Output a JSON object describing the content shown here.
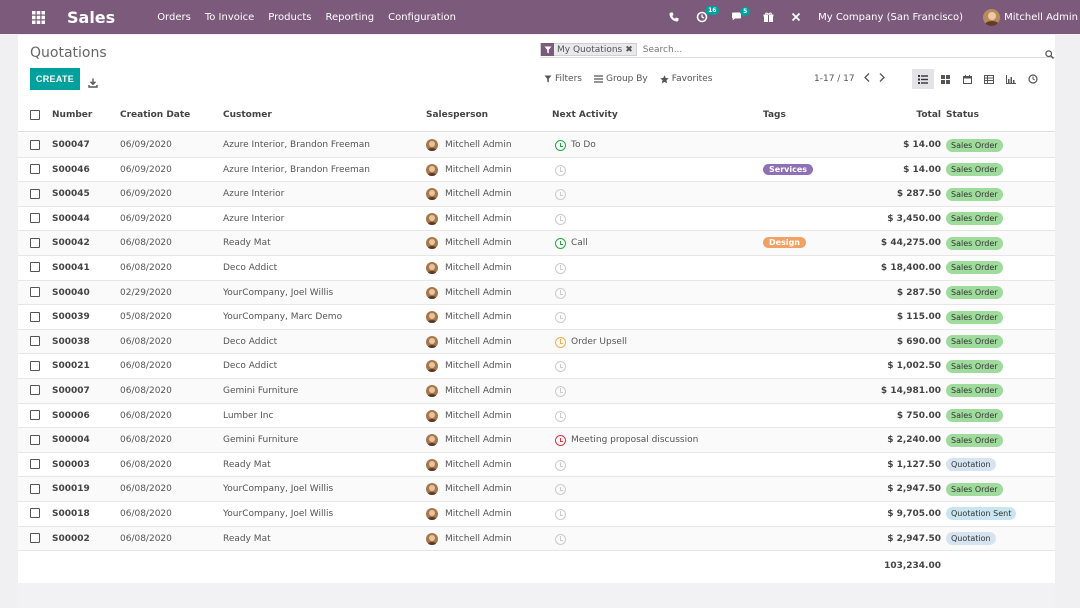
{
  "topbar": {
    "app_title": "Sales",
    "menu": [
      "Orders",
      "To Invoice",
      "Products",
      "Reporting",
      "Configuration"
    ],
    "activity_count": "16",
    "message_count": "5",
    "company": "My Company (San Francisco)",
    "user": "Mitchell Admin"
  },
  "breadcrumb": "Quotations",
  "search": {
    "facet_label": "My Quotations",
    "placeholder": "Search..."
  },
  "toolbar": {
    "create_label": "CREATE",
    "filters_label": "Filters",
    "groupby_label": "Group By",
    "favorites_label": "Favorites",
    "pager": "1-17 / 17"
  },
  "columns": {
    "number": "Number",
    "creation_date": "Creation Date",
    "customer": "Customer",
    "salesperson": "Salesperson",
    "next_activity": "Next Activity",
    "tags": "Tags",
    "total": "Total",
    "status": "Status"
  },
  "rows": [
    {
      "number": "S00047",
      "date": "06/09/2020",
      "customer": "Azure Interior, Brandon Freeman",
      "salesperson": "Mitchell Admin",
      "activity": "To Do",
      "activity_state": "todo",
      "tag": "",
      "total": "$ 14.00",
      "status": "Sales Order"
    },
    {
      "number": "S00046",
      "date": "06/09/2020",
      "customer": "Azure Interior, Brandon Freeman",
      "salesperson": "Mitchell Admin",
      "activity": "",
      "activity_state": "empty",
      "tag": "Services",
      "total": "$ 14.00",
      "status": "Sales Order"
    },
    {
      "number": "S00045",
      "date": "06/09/2020",
      "customer": "Azure Interior",
      "salesperson": "Mitchell Admin",
      "activity": "",
      "activity_state": "empty",
      "tag": "",
      "total": "$ 287.50",
      "status": "Sales Order"
    },
    {
      "number": "S00044",
      "date": "06/09/2020",
      "customer": "Azure Interior",
      "salesperson": "Mitchell Admin",
      "activity": "",
      "activity_state": "empty",
      "tag": "",
      "total": "$ 3,450.00",
      "status": "Sales Order"
    },
    {
      "number": "S00042",
      "date": "06/08/2020",
      "customer": "Ready Mat",
      "salesperson": "Mitchell Admin",
      "activity": "Call",
      "activity_state": "todo",
      "tag": "Design",
      "total": "$ 44,275.00",
      "status": "Sales Order"
    },
    {
      "number": "S00041",
      "date": "06/08/2020",
      "customer": "Deco Addict",
      "salesperson": "Mitchell Admin",
      "activity": "",
      "activity_state": "empty",
      "tag": "",
      "total": "$ 18,400.00",
      "status": "Sales Order"
    },
    {
      "number": "S00040",
      "date": "02/29/2020",
      "customer": "YourCompany, Joel Willis",
      "salesperson": "Mitchell Admin",
      "activity": "",
      "activity_state": "empty",
      "tag": "",
      "total": "$ 287.50",
      "status": "Sales Order"
    },
    {
      "number": "S00039",
      "date": "05/08/2020",
      "customer": "YourCompany, Marc Demo",
      "salesperson": "Mitchell Admin",
      "activity": "",
      "activity_state": "empty",
      "tag": "",
      "total": "$ 115.00",
      "status": "Sales Order"
    },
    {
      "number": "S00038",
      "date": "06/08/2020",
      "customer": "Deco Addict",
      "salesperson": "Mitchell Admin",
      "activity": "Order Upsell",
      "activity_state": "warn",
      "tag": "",
      "total": "$ 690.00",
      "status": "Sales Order"
    },
    {
      "number": "S00021",
      "date": "06/08/2020",
      "customer": "Deco Addict",
      "salesperson": "Mitchell Admin",
      "activity": "",
      "activity_state": "empty",
      "tag": "",
      "total": "$ 1,002.50",
      "status": "Sales Order"
    },
    {
      "number": "S00007",
      "date": "06/08/2020",
      "customer": "Gemini Furniture",
      "salesperson": "Mitchell Admin",
      "activity": "",
      "activity_state": "empty",
      "tag": "",
      "total": "$ 14,981.00",
      "status": "Sales Order"
    },
    {
      "number": "S00006",
      "date": "06/08/2020",
      "customer": "Lumber Inc",
      "salesperson": "Mitchell Admin",
      "activity": "",
      "activity_state": "empty",
      "tag": "",
      "total": "$ 750.00",
      "status": "Sales Order"
    },
    {
      "number": "S00004",
      "date": "06/08/2020",
      "customer": "Gemini Furniture",
      "salesperson": "Mitchell Admin",
      "activity": "Meeting proposal discussion",
      "activity_state": "late",
      "tag": "",
      "total": "$ 2,240.00",
      "status": "Sales Order"
    },
    {
      "number": "S00003",
      "date": "06/08/2020",
      "customer": "Ready Mat",
      "salesperson": "Mitchell Admin",
      "activity": "",
      "activity_state": "empty",
      "tag": "",
      "total": "$ 1,127.50",
      "status": "Quotation"
    },
    {
      "number": "S00019",
      "date": "06/08/2020",
      "customer": "YourCompany, Joel Willis",
      "salesperson": "Mitchell Admin",
      "activity": "",
      "activity_state": "empty",
      "tag": "",
      "total": "$ 2,947.50",
      "status": "Sales Order"
    },
    {
      "number": "S00018",
      "date": "06/08/2020",
      "customer": "YourCompany, Joel Willis",
      "salesperson": "Mitchell Admin",
      "activity": "",
      "activity_state": "empty",
      "tag": "",
      "total": "$ 9,705.00",
      "status": "Quotation Sent"
    },
    {
      "number": "S00002",
      "date": "06/08/2020",
      "customer": "Ready Mat",
      "salesperson": "Mitchell Admin",
      "activity": "",
      "activity_state": "empty",
      "tag": "",
      "total": "$ 2,947.50",
      "status": "Quotation"
    }
  ],
  "sum_total": "103,234.00",
  "colors": {
    "topbar": "#7b5a7b",
    "primary": "#00a09d",
    "tag_services": "#8f6fb5",
    "tag_design": "#f1a164",
    "status_sales_order": "#9fdb9c",
    "status_quotation": "#d6e4f1",
    "status_quotation_sent": "#c9e6f0"
  }
}
